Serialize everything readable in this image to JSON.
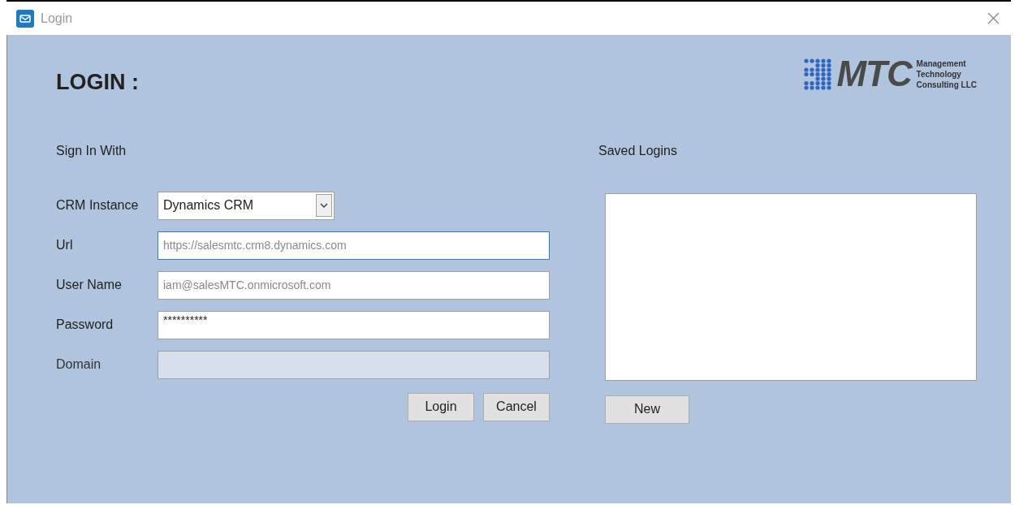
{
  "window": {
    "title": "Login"
  },
  "heading": "LOGIN :",
  "logo": {
    "letters": "MTC",
    "tagline": [
      "Management",
      "Technology",
      "Consulting LLC"
    ]
  },
  "sign_in": {
    "title": "Sign In With",
    "fields": [
      {
        "kind": "select",
        "label": "CRM Instance",
        "value": "Dynamics CRM",
        "focused": false,
        "disabled": false
      },
      {
        "kind": "text",
        "label": "Url",
        "value": "https://salesmtc.crm8.dynamics.com",
        "focused": true,
        "disabled": false
      },
      {
        "kind": "text",
        "label": "User Name",
        "value": "iam@salesMTC.onmicrosoft.com",
        "focused": false,
        "disabled": false
      },
      {
        "kind": "password",
        "label": "Password",
        "value": "**********",
        "focused": false,
        "disabled": false
      },
      {
        "kind": "text",
        "label": "Domain",
        "focused": false,
        "disabled": true
      }
    ],
    "buttons": [
      "Login",
      "Cancel"
    ]
  },
  "saved_logins": {
    "title": "Saved Logins",
    "button": "New"
  }
}
